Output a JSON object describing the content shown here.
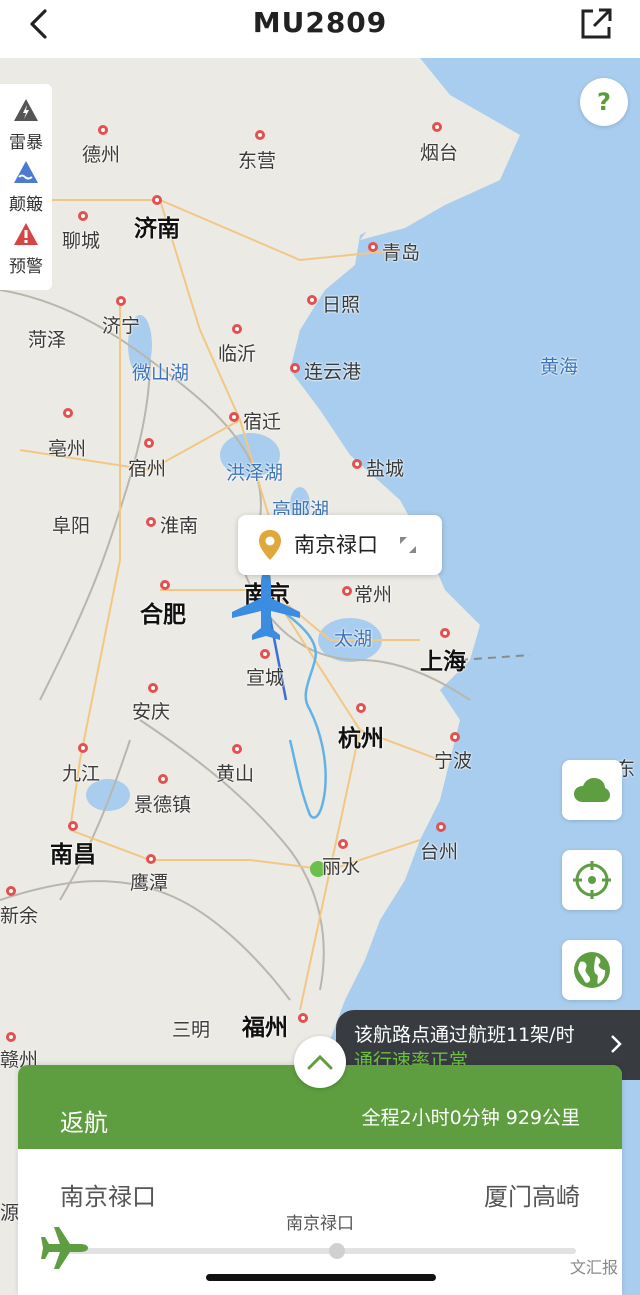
{
  "header": {
    "title": "MU2809",
    "back_icon": "chevron-left-icon",
    "share_icon": "share-external-icon"
  },
  "legend": [
    {
      "label": "雷暴",
      "icon": "thunderstorm-icon",
      "color": "#555555"
    },
    {
      "label": "颠簸",
      "icon": "turbulence-icon",
      "color": "#4a7bd0"
    },
    {
      "label": "预警",
      "icon": "warning-icon",
      "color": "#d64545"
    }
  ],
  "help": {
    "label": "?"
  },
  "map": {
    "cities": [
      {
        "name": "德州"
      },
      {
        "name": "东营"
      },
      {
        "name": "烟台"
      },
      {
        "name": "济南"
      },
      {
        "name": "聊城"
      },
      {
        "name": "青岛"
      },
      {
        "name": "日照"
      },
      {
        "name": "菏泽"
      },
      {
        "name": "济宁"
      },
      {
        "name": "临沂"
      },
      {
        "name": "微山湖"
      },
      {
        "name": "连云港"
      },
      {
        "name": "黄海"
      },
      {
        "name": "亳州"
      },
      {
        "name": "宿州"
      },
      {
        "name": "宿迁"
      },
      {
        "name": "洪泽湖"
      },
      {
        "name": "盐城"
      },
      {
        "name": "高邮湖"
      },
      {
        "name": "阜阳"
      },
      {
        "name": "淮南"
      },
      {
        "name": "合肥"
      },
      {
        "name": "南京"
      },
      {
        "name": "常州"
      },
      {
        "name": "太湖"
      },
      {
        "name": "上海"
      },
      {
        "name": "安庆"
      },
      {
        "name": "宣城"
      },
      {
        "name": "杭州"
      },
      {
        "name": "宁波"
      },
      {
        "name": "九江"
      },
      {
        "name": "黄山"
      },
      {
        "name": "景德镇"
      },
      {
        "name": "东"
      },
      {
        "name": "南昌"
      },
      {
        "name": "丽水"
      },
      {
        "name": "台州"
      },
      {
        "name": "鹰潭"
      },
      {
        "name": "新余"
      },
      {
        "name": "三明"
      },
      {
        "name": "福州"
      },
      {
        "name": "赣州"
      },
      {
        "name": "源"
      }
    ]
  },
  "popup": {
    "airport": "南京禄口",
    "pin_icon": "location-pin-icon",
    "expand_icon": "expand-icon"
  },
  "side_buttons": [
    {
      "icon": "cloud-icon"
    },
    {
      "icon": "locate-crosshair-icon"
    },
    {
      "icon": "globe-icon"
    }
  ],
  "notice": {
    "line1": "该航路点通过航班11架/时",
    "line2": "通行速率正常",
    "arrow_icon": "chevron-right-icon"
  },
  "card": {
    "status": "返航",
    "summary": "全程2小时0分钟 929公里",
    "origin": "南京禄口",
    "destination": "厦门高崎",
    "progress_label": "南京禄口",
    "progress": 0.53,
    "accent": "#5f9e40"
  },
  "watermark": "文汇报"
}
